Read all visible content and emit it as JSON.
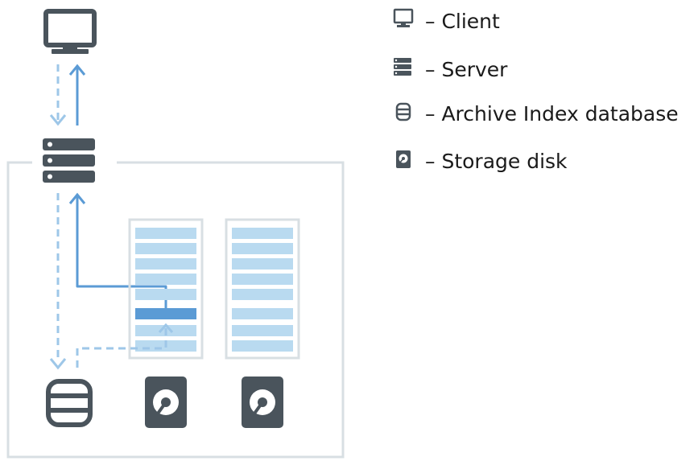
{
  "legend": {
    "items": [
      {
        "icon": "monitor-icon",
        "label": "– Client"
      },
      {
        "icon": "server-icon",
        "label": "– Server"
      },
      {
        "icon": "database-icon",
        "label": "– Archive Index database"
      },
      {
        "icon": "disk-icon",
        "label": "– Storage disk"
      }
    ]
  },
  "colors": {
    "icon_dark": "#4a545c",
    "flow_blue": "#5b9bd5",
    "flow_dashed": "#9ec7e8",
    "slot_light": "#b9daf0",
    "slot_highlight": "#5b9bd5",
    "frame_gray": "#d8dfe3"
  }
}
